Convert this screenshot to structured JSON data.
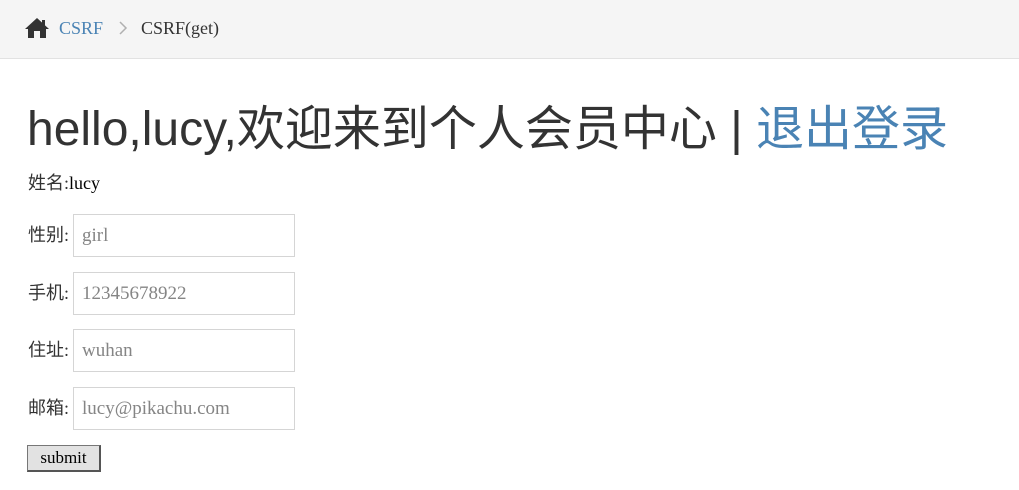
{
  "breadcrumb": {
    "home_icon": "home-icon",
    "link_label": "CSRF",
    "separator_icon": "chevron-right-icon",
    "current_label": "CSRF(get)"
  },
  "title": {
    "greeting": "hello,lucy,欢迎来到个人会员中心 | ",
    "logout_label": "退出登录"
  },
  "profile": {
    "name_label": "姓名:",
    "name_value": "lucy",
    "fields": [
      {
        "label": "性别:",
        "placeholder": "girl"
      },
      {
        "label": "手机:",
        "placeholder": "12345678922"
      },
      {
        "label": "住址:",
        "placeholder": "wuhan"
      },
      {
        "label": "邮箱:",
        "placeholder": "lucy@pikachu.com"
      }
    ],
    "submit_label": "submit"
  },
  "colors": {
    "link": "#4a83b4",
    "text": "#333333",
    "breadcrumb_bg": "#f5f5f5",
    "input_border": "#d5d5d5"
  }
}
